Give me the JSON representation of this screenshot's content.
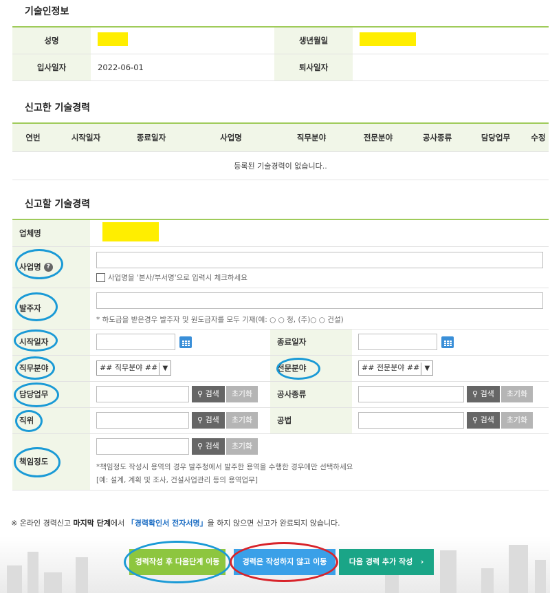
{
  "section1": {
    "title": "기술인정보",
    "name_label": "성명",
    "birth_label": "생년월일",
    "hire_label": "입사일자",
    "hire_value": "2022-06-01",
    "resign_label": "퇴사일자",
    "resign_value": ""
  },
  "section2": {
    "title": "신고한 기술경력",
    "columns": [
      "연번",
      "시작일자",
      "종료일자",
      "사업명",
      "직무분야",
      "전문분야",
      "공사종류",
      "담당업무",
      "수정"
    ],
    "empty_message": "등록된 기술경력이 없습니다.."
  },
  "section3": {
    "title": "신고할 기술경력",
    "company_label": "업체명",
    "project_label": "사업명",
    "project_checkbox_label": "사업명을 '본사/부서명'으로 입력시 체크하세요",
    "client_label": "발주자",
    "client_hint": "* 하도급을 받은경우 발주자 및 원도급자를 모두 기재(예: ○ ○ 청, (주)○ ○ 건설)",
    "start_label": "시작일자",
    "end_label": "종료일자",
    "job_field_label": "직무분야",
    "job_field_select": "## 직무분야 ##",
    "special_field_label": "전문분야",
    "special_field_select": "## 전문분야 ##",
    "duty_label": "담당업무",
    "construction_type_label": "공사종류",
    "position_label": "직위",
    "method_label": "공법",
    "responsibility_label": "책임정도",
    "responsibility_hint1": "*책임정도 작성시 용역의 경우 발주청에서 발주한 용역을 수행한 경우에만 선택하세요",
    "responsibility_hint2": "[예: 설계, 계획 및 조사, 건설사업관리 등의 용역업무]",
    "search_label": "검색",
    "reset_label": "초기화"
  },
  "notice": {
    "prefix": "※ 온라인 경력신고 ",
    "bold": "마지막 단계",
    "mid": "에서 ",
    "blue": "「경력확인서 전자서명」",
    "suffix": "을 하지 않으면 신고가 완료되지 않습니다."
  },
  "buttons": {
    "next_step": "경력작성 후 다음단계 이동",
    "move_without": "경력은 작성하지 않고 이동",
    "add_more": "다음 경력 추가 작성",
    "add_more_arrow": "›"
  },
  "colors": {
    "accent_green": "#9fcb5a",
    "label_bg": "#f1f6e8",
    "highlight_yellow": "#ffee00",
    "circle_blue": "#1a9ad6",
    "circle_red": "#d8232a",
    "btn_green": "#8dc63f",
    "btn_blue": "#3aa0e8",
    "btn_teal": "#1aa587"
  }
}
